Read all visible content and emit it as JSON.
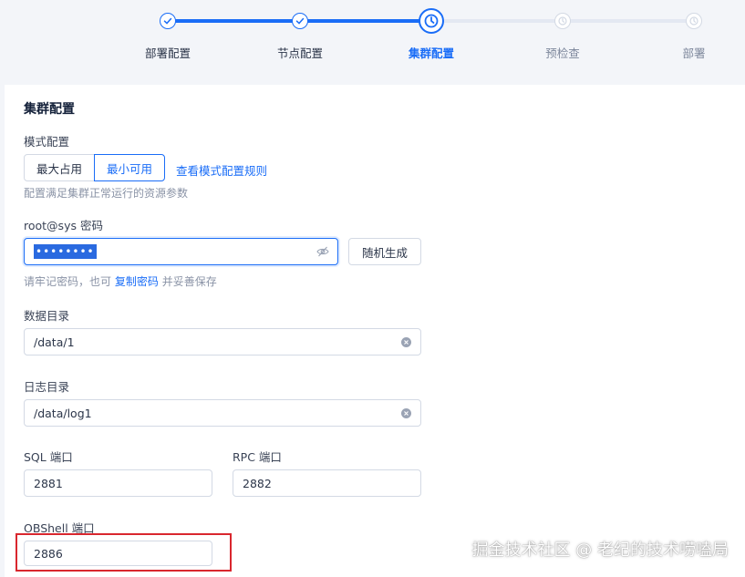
{
  "steps": [
    {
      "label": "部署配置",
      "status": "done"
    },
    {
      "label": "节点配置",
      "status": "done"
    },
    {
      "label": "集群配置",
      "status": "active"
    },
    {
      "label": "预检查",
      "status": "todo"
    },
    {
      "label": "部署",
      "status": "todo"
    }
  ],
  "colors": {
    "accent": "#1a6df7",
    "highlight": "#d9272e"
  },
  "cluster": {
    "title": "集群配置",
    "mode": {
      "label": "模式配置",
      "options": [
        "最大占用",
        "最小可用"
      ],
      "selected": "最小可用",
      "rules_link": "查看模式配置规则",
      "hint": "配置满足集群正常运行的资源参数"
    },
    "password": {
      "label": "root@sys 密码",
      "value": "••••••••",
      "generate_button": "随机生成",
      "hint_prefix": "请牢记密码，也可",
      "hint_link": "复制密码",
      "hint_suffix": "并妥善保存"
    },
    "data_dir": {
      "label": "数据目录",
      "value": "/data/1"
    },
    "log_dir": {
      "label": "日志目录",
      "value": "/data/log1"
    },
    "sql_port": {
      "label": "SQL 端口",
      "value": "2881"
    },
    "rpc_port": {
      "label": "RPC 端口",
      "value": "2882"
    },
    "obshell_port": {
      "label": "OBShell 端口",
      "value": "2886"
    }
  },
  "watermark": "掘金技术社区 @ 老纪的技术唠嗑局"
}
